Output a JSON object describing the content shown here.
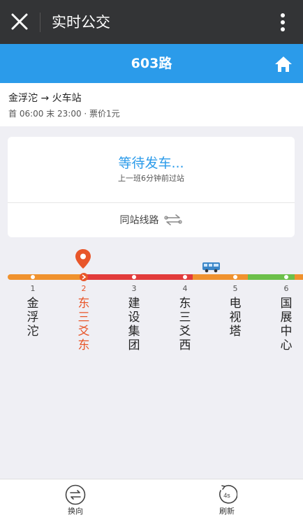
{
  "titlebar": {
    "title": "实时公交"
  },
  "route": {
    "name": "603路"
  },
  "info": {
    "direction": "金浮沱 → 火车站",
    "times": "首 06:00 末 23:00 · 票价1元"
  },
  "card": {
    "status": "等待发车...",
    "subtitle": "上一班6分钟前过站",
    "same_station_label": "同站线路"
  },
  "stops": [
    {
      "num": "1",
      "name": "金浮沱"
    },
    {
      "num": "2",
      "name": "东三爻东"
    },
    {
      "num": "3",
      "name": "建设集团"
    },
    {
      "num": "4",
      "name": "东三爻西"
    },
    {
      "num": "5",
      "name": "电视塔"
    },
    {
      "num": "6",
      "name": "国展中心"
    }
  ],
  "current_stop_index": 1,
  "colors": {
    "titlebar": "#333436",
    "accent": "#2b9bea",
    "current": "#e8562a",
    "traffic_slow": "#f0922e",
    "traffic_congested": "#e23b3b",
    "traffic_smooth": "#6cc04a"
  },
  "bottom": {
    "reverse_label": "换向",
    "refresh_label": "刷新",
    "refresh_countdown": "4s"
  }
}
